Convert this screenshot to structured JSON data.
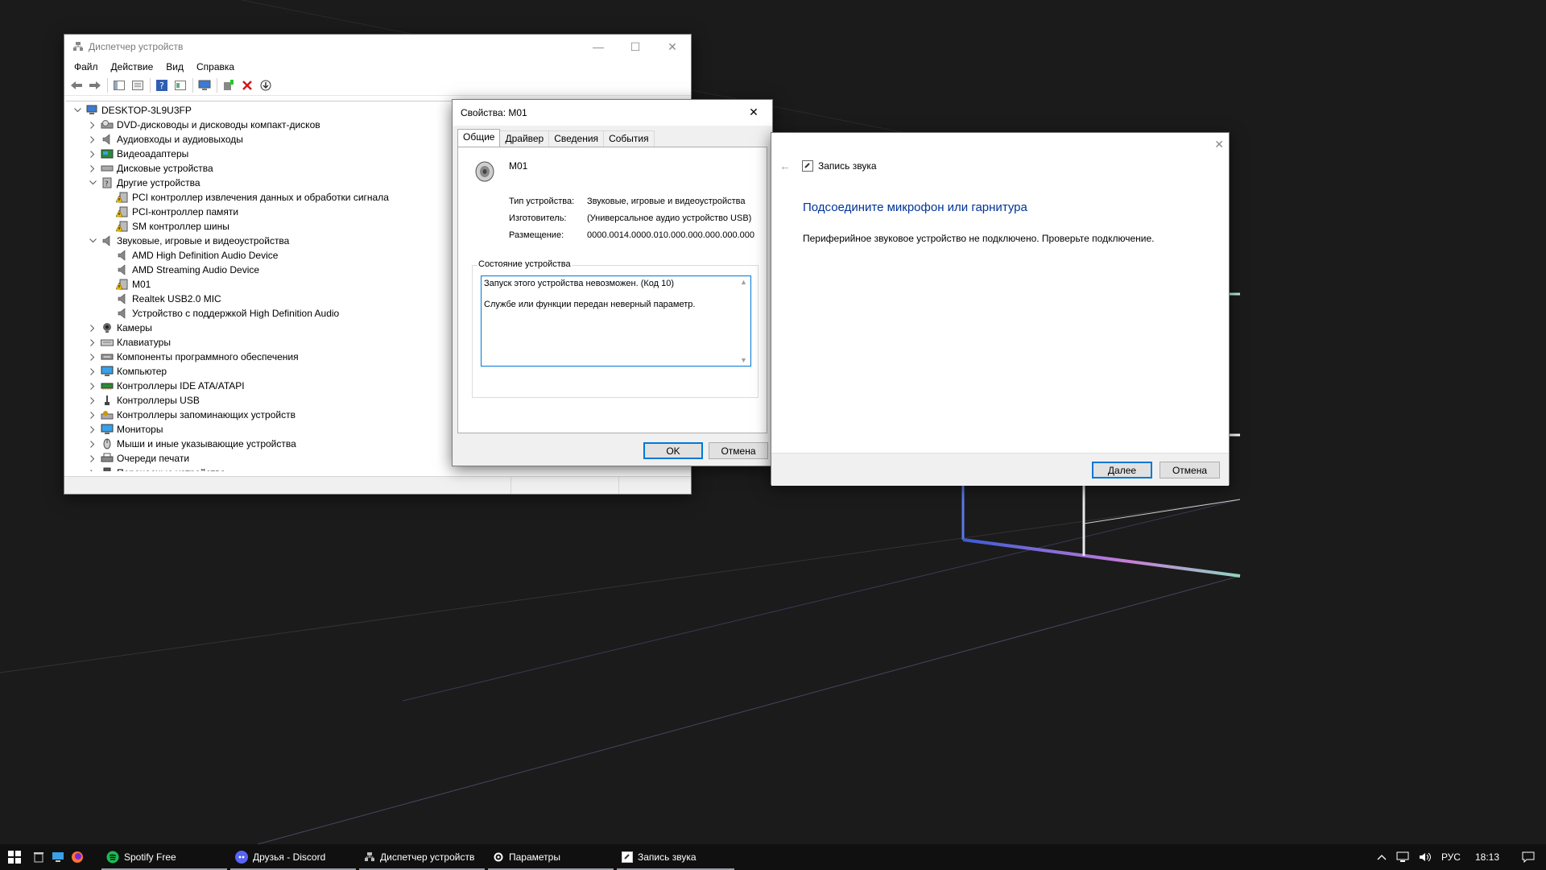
{
  "device_manager": {
    "title": "Диспетчер устройств",
    "menu": [
      "Файл",
      "Действие",
      "Вид",
      "Справка"
    ],
    "tree": [
      {
        "label": "DESKTOP-3L9U3FP",
        "level": 0,
        "arrow": "v",
        "icon": "computer-icon"
      },
      {
        "label": "DVD-дисководы и дисководы компакт-дисков",
        "level": 1,
        "arrow": ">",
        "icon": "dvd-drive-icon"
      },
      {
        "label": "Аудиовходы и аудиовыходы",
        "level": 1,
        "arrow": ">",
        "icon": "speaker-icon"
      },
      {
        "label": "Видеоадаптеры",
        "level": 1,
        "arrow": ">",
        "icon": "display-adapter-icon"
      },
      {
        "label": "Дисковые устройства",
        "level": 1,
        "arrow": ">",
        "icon": "disk-drive-icon"
      },
      {
        "label": "Другие устройства",
        "level": 1,
        "arrow": "v",
        "icon": "unknown-device-icon"
      },
      {
        "label": "PCI контроллер извлечения данных и обработки сигнала",
        "level": 2,
        "arrow": "",
        "icon": "warning-device-icon"
      },
      {
        "label": "PCI-контроллер памяти",
        "level": 2,
        "arrow": "",
        "icon": "warning-device-icon"
      },
      {
        "label": "SM контроллер шины",
        "level": 2,
        "arrow": "",
        "icon": "warning-device-icon"
      },
      {
        "label": "Звуковые, игровые и видеоустройства",
        "level": 1,
        "arrow": "v",
        "icon": "speaker-icon"
      },
      {
        "label": "AMD High Definition Audio Device",
        "level": 2,
        "arrow": "",
        "icon": "speaker-icon"
      },
      {
        "label": "AMD Streaming Audio Device",
        "level": 2,
        "arrow": "",
        "icon": "speaker-icon"
      },
      {
        "label": "M01",
        "level": 2,
        "arrow": "",
        "icon": "warning-device-icon"
      },
      {
        "label": "Realtek USB2.0 MIC",
        "level": 2,
        "arrow": "",
        "icon": "speaker-icon"
      },
      {
        "label": "Устройство с поддержкой High Definition Audio",
        "level": 2,
        "arrow": "",
        "icon": "speaker-icon"
      },
      {
        "label": "Камеры",
        "level": 1,
        "arrow": ">",
        "icon": "camera-icon"
      },
      {
        "label": "Клавиатуры",
        "level": 1,
        "arrow": ">",
        "icon": "keyboard-icon"
      },
      {
        "label": "Компоненты программного обеспечения",
        "level": 1,
        "arrow": ">",
        "icon": "software-component-icon"
      },
      {
        "label": "Компьютер",
        "level": 1,
        "arrow": ">",
        "icon": "monitor-icon"
      },
      {
        "label": "Контроллеры IDE ATA/ATAPI",
        "level": 1,
        "arrow": ">",
        "icon": "ide-controller-icon"
      },
      {
        "label": "Контроллеры USB",
        "level": 1,
        "arrow": ">",
        "icon": "usb-icon"
      },
      {
        "label": "Контроллеры запоминающих устройств",
        "level": 1,
        "arrow": ">",
        "icon": "storage-controller-icon"
      },
      {
        "label": "Мониторы",
        "level": 1,
        "arrow": ">",
        "icon": "monitor-icon"
      },
      {
        "label": "Мыши и иные указывающие устройства",
        "level": 1,
        "arrow": ">",
        "icon": "mouse-icon"
      },
      {
        "label": "Очереди печати",
        "level": 1,
        "arrow": ">",
        "icon": "printer-icon"
      },
      {
        "label": "Переносные устройства",
        "level": 1,
        "arrow": ">",
        "icon": "portable-device-icon"
      }
    ]
  },
  "properties": {
    "title": "Свойства: M01",
    "tabs": [
      "Общие",
      "Драйвер",
      "Сведения",
      "События"
    ],
    "active_tab": "Общие",
    "device_name": "M01",
    "rows": [
      {
        "key": "Тип устройства:",
        "value": "Звуковые, игровые и видеоустройства"
      },
      {
        "key": "Изготовитель:",
        "value": "(Универсальное аудио устройство USB)"
      },
      {
        "key": "Размещение:",
        "value": "0000.0014.0000.010.000.000.000.000.000"
      }
    ],
    "status_legend": "Состояние устройства",
    "status_line1": "Запуск этого устройства невозможен. (Код 10)",
    "status_line2": "Службе или функции передан неверный параметр.",
    "ok_label": "OK",
    "cancel_label": "Отмена"
  },
  "wizard": {
    "header": "Запись звука",
    "title": "Подсоедините микрофон или гарнитура",
    "text": "Периферийное звуковое устройство не подключено. Проверьте подключение.",
    "next_label": "Далее",
    "cancel_label": "Отмена",
    "link_color": "#003399"
  },
  "taskbar": {
    "apps": [
      {
        "label": "Spotify Free",
        "icon": "spotify-icon"
      },
      {
        "label": "Друзья - Discord",
        "icon": "discord-icon"
      },
      {
        "label": "Диспетчер устройств",
        "icon": "device-manager-icon"
      },
      {
        "label": "Параметры",
        "icon": "settings-gear-icon"
      },
      {
        "label": "Запись звука",
        "icon": "sound-record-icon"
      }
    ],
    "language": "РУС",
    "time": "18:13"
  }
}
